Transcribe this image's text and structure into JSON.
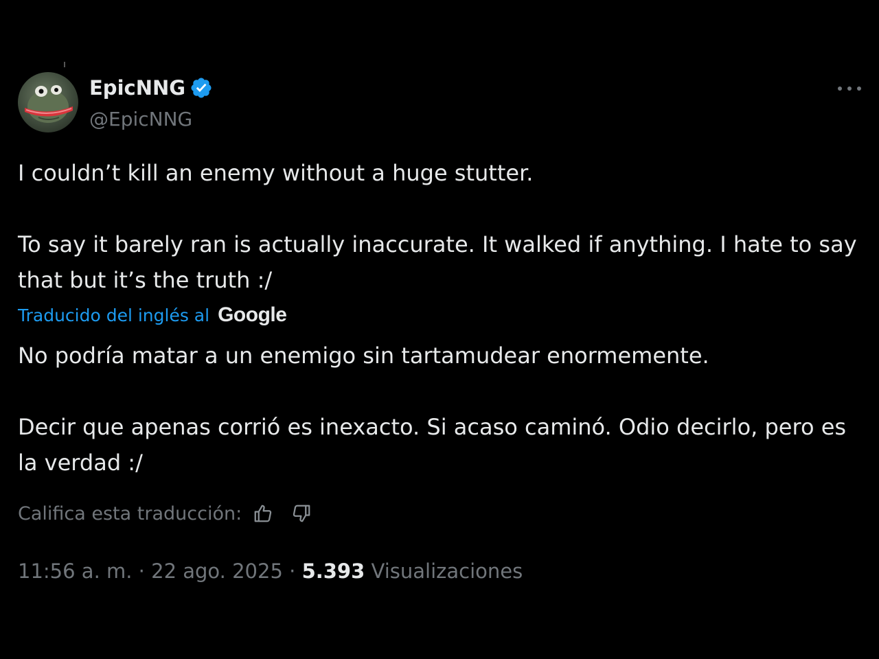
{
  "author": {
    "name": "EpicNNG",
    "handle": "@EpicNNG",
    "verified": true,
    "avatar_icon": "frog-avatar"
  },
  "tweet": {
    "original_text": "I couldn’t kill an enemy without a huge stutter.\n\nTo say it barely ran is actually inaccurate. It walked if anything. I hate to say that but it’s the truth :/",
    "translation_note": "Traducido del inglés al",
    "translation_provider": "Google",
    "translated_text": "No podría matar a un enemigo sin tartamudear enormemente.\n\nDecir que apenas corrió es inexacto. Si acaso caminó. Odio decirlo, pero es la verdad :/"
  },
  "rating": {
    "label": "Califica esta traducción:",
    "like_icon": "thumbs-up-icon",
    "dislike_icon": "thumbs-down-icon"
  },
  "meta": {
    "time": "11:56 a. m.",
    "separator": " · ",
    "date": "22 ago. 2025",
    "views_count": "5.393",
    "views_label": "Visualizaciones"
  },
  "colors": {
    "background": "#000000",
    "text": "#e7e9ea",
    "secondary": "#71767b",
    "accent": "#1d9bf0"
  }
}
